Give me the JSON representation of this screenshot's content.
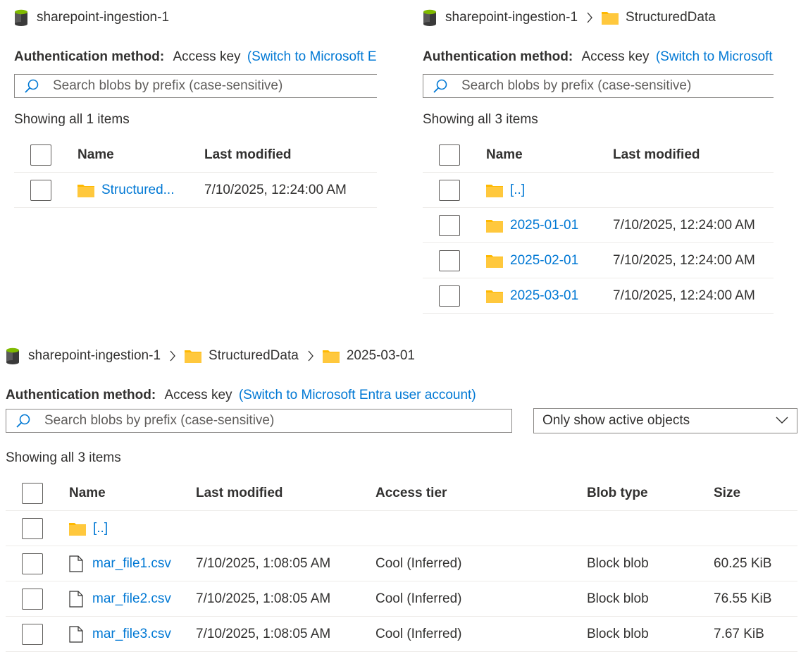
{
  "panel1": {
    "breadcrumb": {
      "container": "sharepoint-ingestion-1"
    },
    "auth": {
      "label": "Authentication method:",
      "value": "Access key",
      "link": "(Switch to Microsoft Entra user account)"
    },
    "search": {
      "placeholder": "Search blobs by prefix (case-sensitive)"
    },
    "count": "Showing all 1 items",
    "columns": {
      "name": "Name",
      "modified": "Last modified"
    },
    "rows": [
      {
        "name": "Structured...",
        "modified": "7/10/2025, 12:24:00 AM",
        "icon": "folder-icon"
      }
    ]
  },
  "panel2": {
    "breadcrumb": {
      "container": "sharepoint-ingestion-1",
      "folder": "StructuredData"
    },
    "auth": {
      "label": "Authentication method:",
      "value": "Access key",
      "link": "(Switch to Microsoft Entra user account)"
    },
    "search": {
      "placeholder": "Search blobs by prefix (case-sensitive)"
    },
    "count": "Showing all 3 items",
    "columns": {
      "name": "Name",
      "modified": "Last modified"
    },
    "rows": [
      {
        "name": "[..]",
        "modified": "",
        "icon": "folder-icon"
      },
      {
        "name": "2025-01-01",
        "modified": "7/10/2025, 12:24:00 AM",
        "icon": "folder-icon"
      },
      {
        "name": "2025-02-01",
        "modified": "7/10/2025, 12:24:00 AM",
        "icon": "folder-icon"
      },
      {
        "name": "2025-03-01",
        "modified": "7/10/2025, 12:24:00 AM",
        "icon": "folder-icon"
      }
    ]
  },
  "panel3": {
    "breadcrumb": {
      "container": "sharepoint-ingestion-1",
      "folder1": "StructuredData",
      "folder2": "2025-03-01"
    },
    "auth": {
      "label": "Authentication method:",
      "value": "Access key",
      "link": "(Switch to Microsoft Entra user account)"
    },
    "search": {
      "placeholder": "Search blobs by prefix (case-sensitive)"
    },
    "filter": {
      "value": "Only show active objects"
    },
    "count": "Showing all 3 items",
    "columns": {
      "name": "Name",
      "modified": "Last modified",
      "tier": "Access tier",
      "type": "Blob type",
      "size": "Size"
    },
    "rows": [
      {
        "name": "[..]",
        "modified": "",
        "tier": "",
        "type": "",
        "size": "",
        "icon": "folder-icon"
      },
      {
        "name": "mar_file1.csv",
        "modified": "7/10/2025, 1:08:05 AM",
        "tier": "Cool (Inferred)",
        "type": "Block blob",
        "size": "60.25 KiB",
        "icon": "file-icon"
      },
      {
        "name": "mar_file2.csv",
        "modified": "7/10/2025, 1:08:05 AM",
        "tier": "Cool (Inferred)",
        "type": "Block blob",
        "size": "76.55 KiB",
        "icon": "file-icon"
      },
      {
        "name": "mar_file3.csv",
        "modified": "7/10/2025, 1:08:05 AM",
        "tier": "Cool (Inferred)",
        "type": "Block blob",
        "size": "7.67 KiB",
        "icon": "file-icon"
      }
    ]
  },
  "colors": {
    "link": "#0078d4",
    "folder": "#ffb900",
    "text": "#323130",
    "border": "#8a8886"
  }
}
